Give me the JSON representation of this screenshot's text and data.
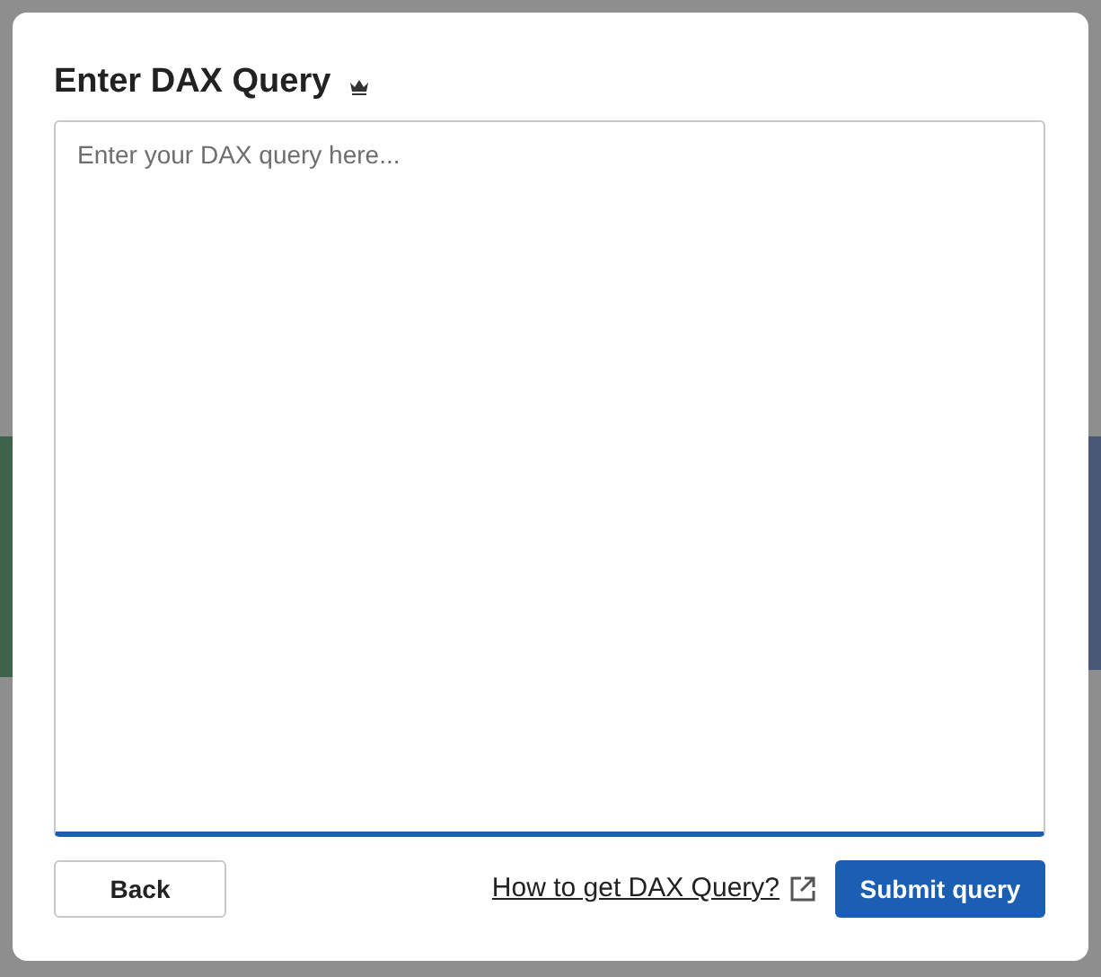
{
  "dialog": {
    "title": "Enter DAX Query",
    "query_field": {
      "placeholder": "Enter your DAX query here..."
    },
    "back_button": "Back",
    "help_link": "How to get DAX Query?",
    "submit_button": "Submit query"
  }
}
